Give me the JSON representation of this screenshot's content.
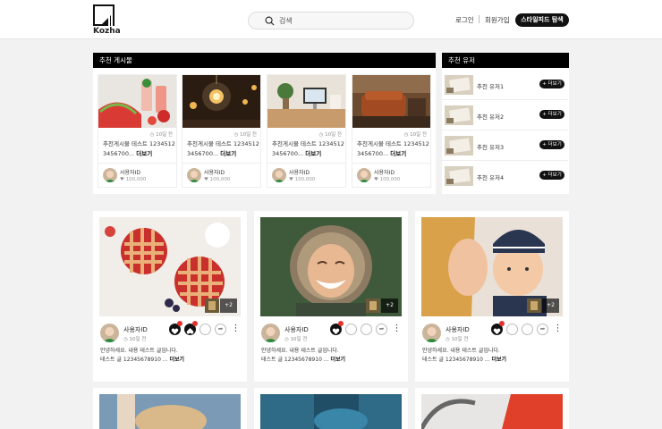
{
  "header": {
    "logo_text": "Kozha",
    "search_placeholder": "검색",
    "login": "로그인",
    "signup": "회원가입",
    "style_feed": "스타일피드 탐색"
  },
  "recommended_posts": {
    "title": "추천 게시물",
    "items": [
      {
        "date": "10일 전",
        "line1": "추천게시물 테스트 1234512",
        "line2": "3456700...",
        "more": "더보기",
        "user": "사용자ID",
        "likes": "100,000"
      },
      {
        "date": "10일 전",
        "line1": "추천게시물 테스트 1234512",
        "line2": "3456700...",
        "more": "더보기",
        "user": "사용자ID",
        "likes": "100,000"
      },
      {
        "date": "10일 전",
        "line1": "추천게시물 테스트 1234512",
        "line2": "3456700...",
        "more": "더보기",
        "user": "사용자ID",
        "likes": "100,000"
      },
      {
        "date": "10일 전",
        "line1": "추천게시물 테스트 1234512",
        "line2": "3456700...",
        "more": "더보기",
        "user": "사용자ID",
        "likes": "100,000"
      }
    ]
  },
  "recommended_users": {
    "title": "추천 유저",
    "items": [
      {
        "name": "추천 유저1",
        "more": "+ 더보기"
      },
      {
        "name": "추천 유저2",
        "more": "+ 더보기"
      },
      {
        "name": "추천 유저3",
        "more": "+ 더보기"
      },
      {
        "name": "추천 유저4",
        "more": "+ 더보기"
      }
    ]
  },
  "feed": [
    {
      "plus": "+2",
      "user": "사용자ID",
      "date": "10일 전",
      "text1": "안녕하세요. 내용 테스트 글입니다.",
      "text2": "테스트 글 12345678910 ...",
      "more": "더보기"
    },
    {
      "plus": "+2",
      "user": "사용자ID",
      "date": "10일 전",
      "text1": "안녕하세요. 내용 테스트 글입니다.",
      "text2": "테스트 글 12345678910 ...",
      "more": "더보기"
    },
    {
      "plus": "+2",
      "user": "사용자ID",
      "date": "10일 전",
      "text1": "안녕하세요. 내용 테스트 글입니다.",
      "text2": "테스트 글 12345678910 ...",
      "more": "더보기"
    }
  ],
  "colors": {
    "accent": "#111111",
    "badge": "#e5322d",
    "background": "#f2f2f2"
  }
}
